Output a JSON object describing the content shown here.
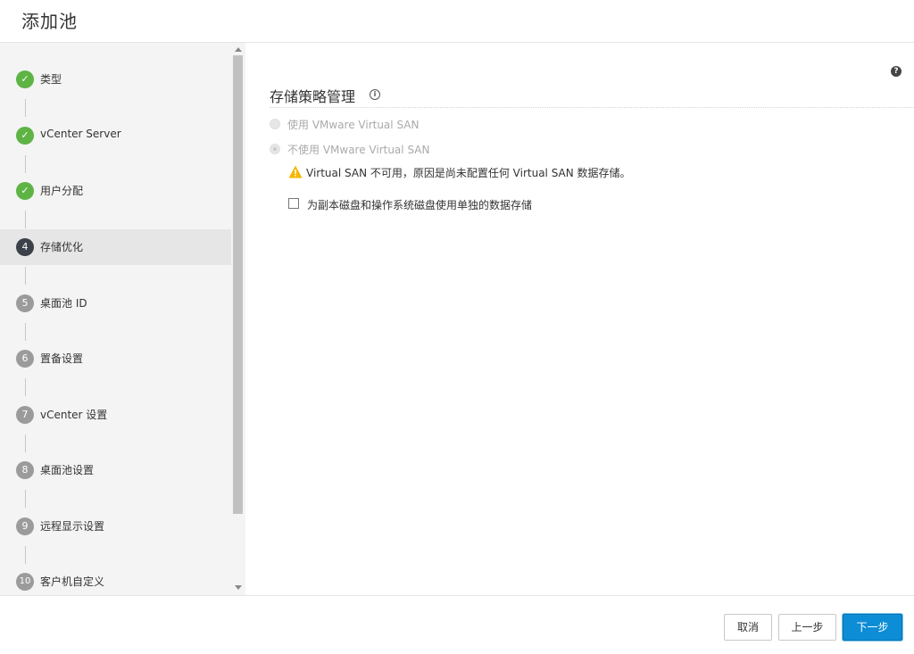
{
  "header": {
    "title": "添加池"
  },
  "steps": [
    {
      "number": "",
      "label": "类型",
      "state": "done"
    },
    {
      "number": "",
      "label": "vCenter Server",
      "state": "done"
    },
    {
      "number": "",
      "label": "用户分配",
      "state": "done"
    },
    {
      "number": "4",
      "label": "存储优化",
      "state": "current"
    },
    {
      "number": "5",
      "label": "桌面池 ID",
      "state": "todo"
    },
    {
      "number": "6",
      "label": "置备设置",
      "state": "todo"
    },
    {
      "number": "7",
      "label": "vCenter 设置",
      "state": "todo"
    },
    {
      "number": "8",
      "label": "桌面池设置",
      "state": "todo"
    },
    {
      "number": "9",
      "label": "远程显示设置",
      "state": "todo"
    },
    {
      "number": "10",
      "label": "客户机自定义",
      "state": "todo"
    }
  ],
  "main": {
    "help_icon": "?",
    "section_title": "存储策略管理",
    "info_icon": "i",
    "options": [
      {
        "label": "使用 VMware Virtual SAN",
        "selected": false,
        "disabled": true
      },
      {
        "label": "不使用 VMware Virtual SAN",
        "selected": true,
        "disabled": true
      }
    ],
    "warning": "Virtual SAN 不可用，原因是尚未配置任何 Virtual SAN 数据存储。",
    "checkbox_label": "为副本磁盘和操作系统磁盘使用单独的数据存储"
  },
  "footer": {
    "cancel_label": "取消",
    "back_label": "上一步",
    "next_label": "下一步"
  },
  "colors": {
    "done": "#5eb345",
    "current": "#3a4148",
    "todo": "#9b9b9b",
    "primary": "#0d8dd6"
  }
}
